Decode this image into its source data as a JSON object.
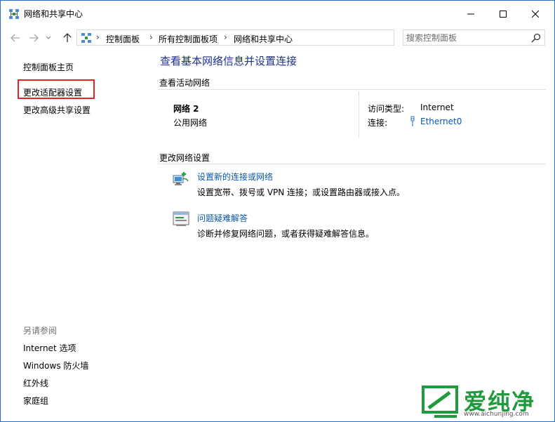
{
  "window": {
    "title": "网络和共享中心"
  },
  "address_bar": {
    "breadcrumbs": [
      "控制面板",
      "所有控制面板项",
      "网络和共享中心"
    ],
    "search_placeholder": "搜索控制面板"
  },
  "sidebar": {
    "links": [
      "控制面板主页",
      "更改适配器设置",
      "更改高级共享设置"
    ],
    "highlighted_link_index": 1,
    "highlight_color": "#d9262b",
    "see_also_title": "另请参阅",
    "see_also_links": [
      "Internet 选项",
      "Windows 防火墙",
      "红外线",
      "家庭组"
    ]
  },
  "main": {
    "heading": "查看基本网络信息并设置连接",
    "active_networks_label": "查看活动网络",
    "network": {
      "name": "网络  2",
      "type": "公用网络",
      "access_type_label": "访问类型:",
      "access_type_value": "Internet",
      "connections_label": "连接:",
      "connection_name": "Ethernet0"
    },
    "change_settings_label": "更改网络设置",
    "tasks": [
      {
        "icon": "new-connection-icon",
        "link": "设置新的连接或网络",
        "description": "设置宽带、拨号或 VPN 连接；或设置路由器或接入点。"
      },
      {
        "icon": "troubleshoot-icon",
        "link": "问题疑难解答",
        "description": "诊断并修复网络问题，或者获得疑难解答信息。"
      }
    ]
  },
  "watermark": {
    "text": "爱纯净",
    "url": "www.aichunjing.com"
  },
  "colors": {
    "heading": "#1e3287",
    "link": "#0c58a8",
    "window_border": "#2b6cc4",
    "watermark_green": "#1f9a3c"
  }
}
